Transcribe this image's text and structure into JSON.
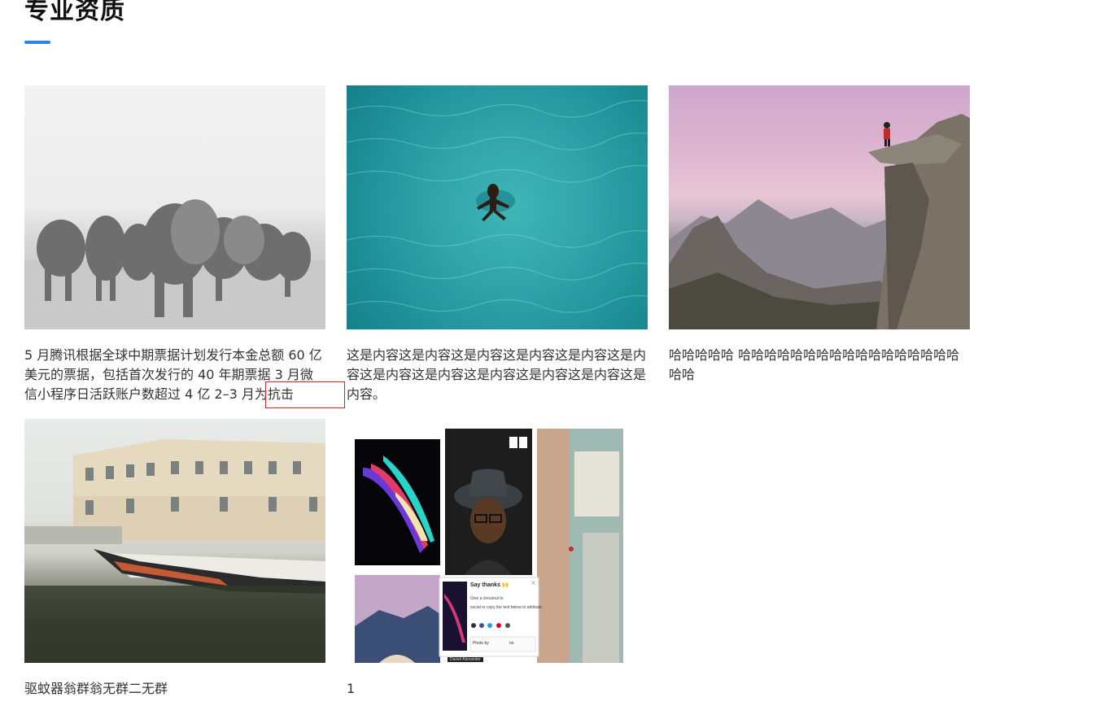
{
  "page": {
    "title": "专业资质"
  },
  "cards": [
    {
      "image_alt": "elephants",
      "text": "5 月腾讯根据全球中期票据计划发行本金总额 60 亿美元的票据，包括首次发行的 40 年期票据 3 月微信小程序日活跃账户数超过 4 亿 2–3 月为抗击"
    },
    {
      "image_alt": "swimmer",
      "text": "这是内容这是内容这是内容这是内容这是内容这是内容这是内容这是内容这是内容这是内容这是内容这是内容。"
    },
    {
      "image_alt": "mountain",
      "text": "哈哈哈哈哈 哈哈哈哈哈哈哈哈哈哈哈哈哈哈哈哈哈哈哈"
    },
    {
      "image_alt": "boat",
      "text": "驱蚊器翁群翁无群二无群"
    },
    {
      "image_alt": "collage",
      "text": "1"
    }
  ],
  "collage": {
    "popup_title": "Say thanks 🙌",
    "popup_line1": "Give a shoutout to",
    "popup_line2": "social or copy the text below to attribute.",
    "popup_photo_by": "Photo by",
    "popup_on": "on",
    "caption": "Daniel Alexander"
  },
  "colors": {
    "accent": "#2f80ed",
    "highlight": "#e02020"
  }
}
